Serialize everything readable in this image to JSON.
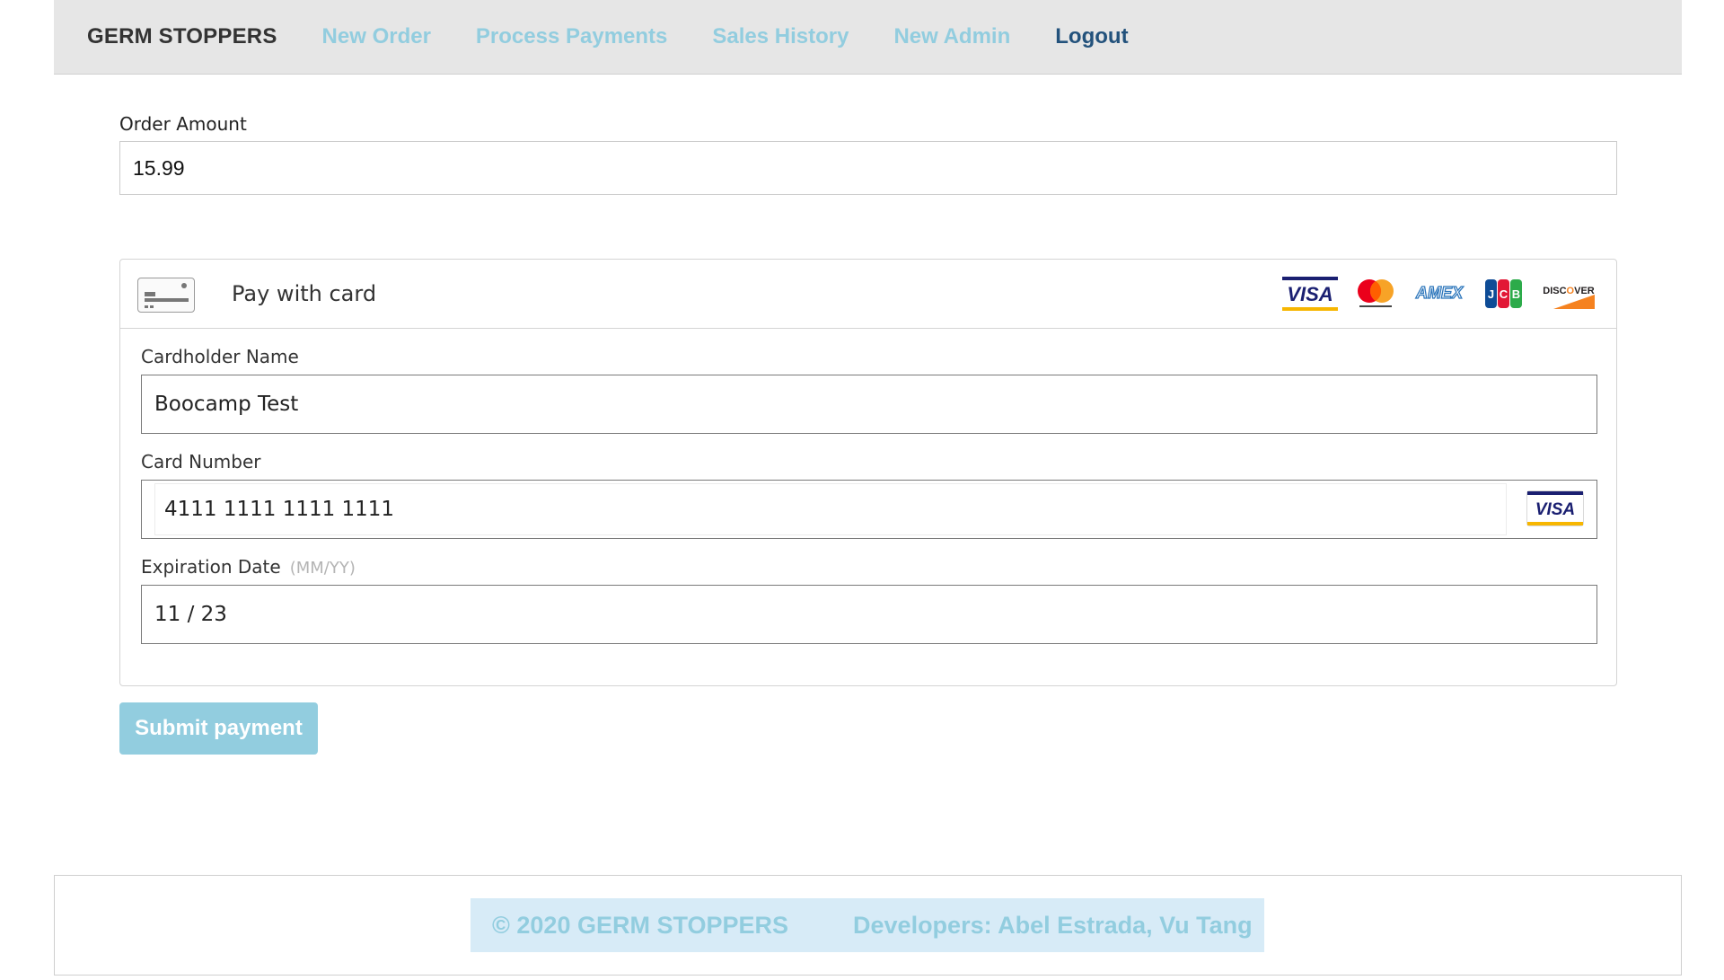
{
  "navbar": {
    "brand": "GERM STOPPERS",
    "links": [
      "New Order",
      "Process Payments",
      "Sales History",
      "New Admin"
    ],
    "logout": "Logout"
  },
  "order": {
    "label": "Order Amount",
    "value": "15.99"
  },
  "payment": {
    "title": "Pay with card",
    "accepted_brands": [
      "visa-logo",
      "mastercard-logo",
      "amex-logo",
      "jcb-logo",
      "discover-logo"
    ],
    "cardholder": {
      "label": "Cardholder Name",
      "value": "Boocamp Test"
    },
    "card_number": {
      "label": "Card Number",
      "value": "4111 1111 1111 1111",
      "detected_brand": "VISA"
    },
    "expiration": {
      "label": "Expiration Date",
      "hint": "(MM/YY)",
      "value": "11 / 23"
    }
  },
  "submit": {
    "label": "Submit payment"
  },
  "footer": {
    "copyright": "© 2020 GERM STOPPERS",
    "developers": "Developers: Abel Estrada, Vu Tang"
  },
  "colors": {
    "nav_link": "#92cddf",
    "logout": "#23527c",
    "submit_bg": "#92cddf",
    "footer_band": "#d7ebf7"
  }
}
